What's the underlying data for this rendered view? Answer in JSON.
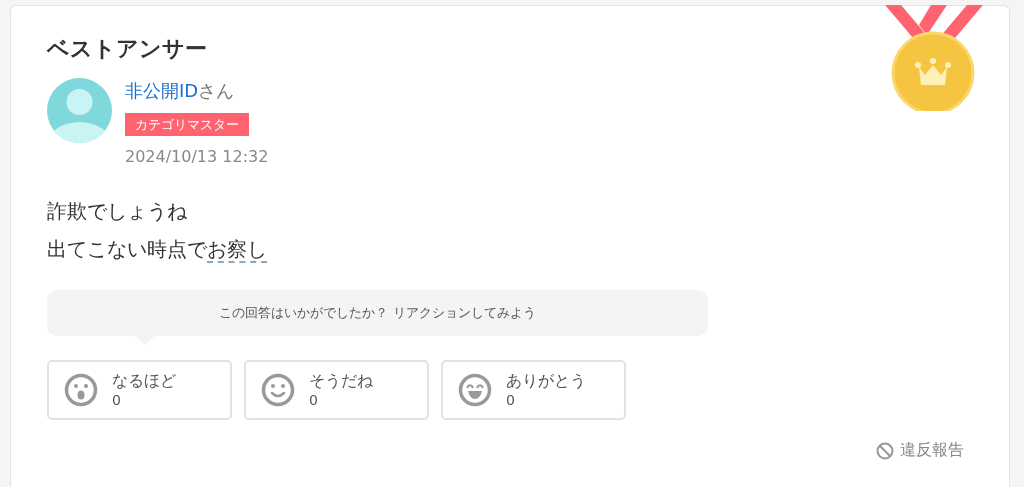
{
  "heading": "ベストアンサー",
  "author": {
    "name": "非公開ID",
    "suffix": "さん",
    "badge": "カテゴリマスター",
    "date": "2024/10/13 12:32"
  },
  "answer": [
    {
      "text": "詐欺でしょうね"
    },
    {
      "text": "出てこない時点で",
      "term": "お察し"
    }
  ],
  "prompt": "この回答はいかがでしたか？ リアクションしてみよう",
  "reactions": [
    {
      "kind": "surprised",
      "label": "なるほど",
      "count": "0"
    },
    {
      "kind": "smile",
      "label": "そうだね",
      "count": "0"
    },
    {
      "kind": "grin",
      "label": "ありがとう",
      "count": "0"
    }
  ],
  "report": "違反報告"
}
